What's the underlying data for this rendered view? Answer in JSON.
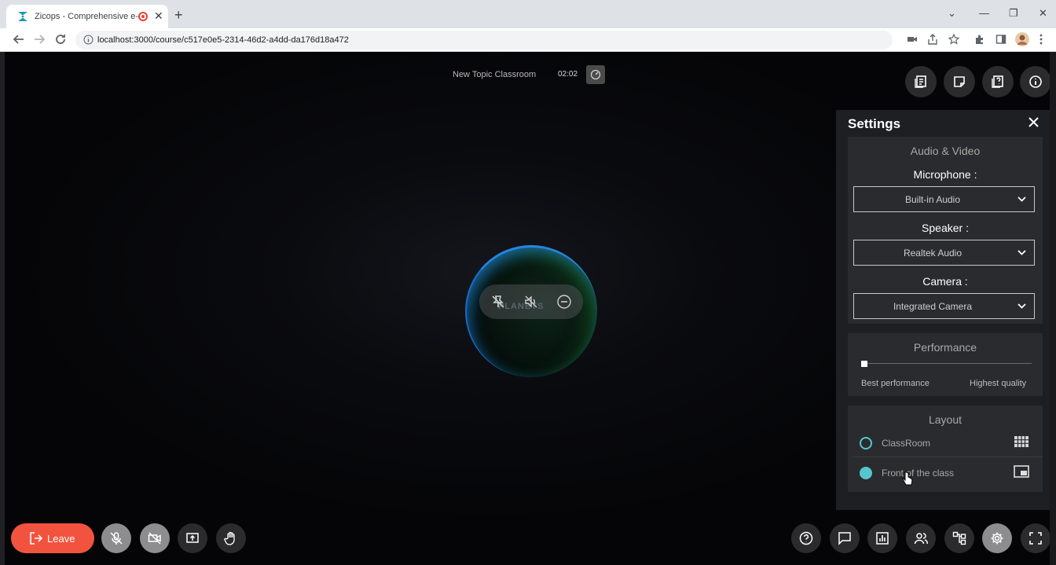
{
  "browser": {
    "tab_title": "Zicops - Comprehensive e-le",
    "url": "localhost:3000/course/c517e0e5-2314-46d2-a4dd-da176d18a472"
  },
  "meeting": {
    "topic": "New Topic Classroom",
    "timer": "02:02",
    "logo_text": "PLANETS"
  },
  "settings": {
    "title": "Settings",
    "audio_video": {
      "title": "Audio & Video",
      "microphone_label": "Microphone :",
      "microphone_value": "Built-in Audio",
      "speaker_label": "Speaker :",
      "speaker_value": "Realtek Audio",
      "camera_label": "Camera :",
      "camera_value": "Integrated Camera"
    },
    "performance": {
      "title": "Performance",
      "slider_value": 0,
      "left_label": "Best performance",
      "right_label": "Highest quality"
    },
    "layout": {
      "title": "Layout",
      "options": [
        {
          "label": "ClassRoom",
          "selected": false,
          "icon": "grid-icon"
        },
        {
          "label": "Front of the class",
          "selected": true,
          "icon": "picture-in-picture-icon"
        }
      ]
    }
  },
  "controls": {
    "leave_label": "Leave"
  },
  "colors": {
    "accent": "#56c5d0",
    "leave": "#f2533f"
  }
}
